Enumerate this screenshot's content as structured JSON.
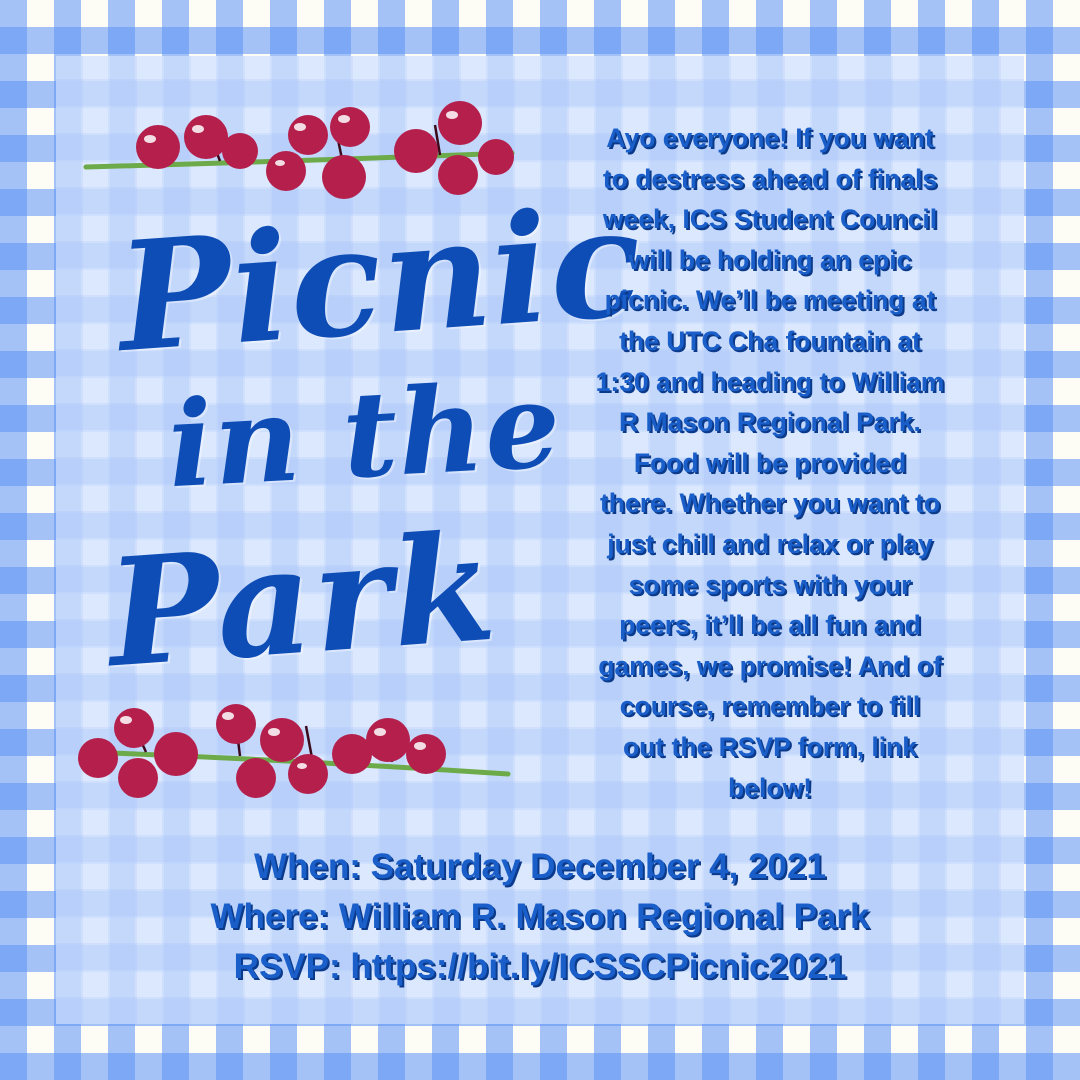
{
  "colors": {
    "gingham_blue": "#5c92f6",
    "gingham_cream": "#fdfdf6",
    "panel": "#d6e4ff",
    "text_blue": "#1a5fc9",
    "text_shadow": "#0b3a8a",
    "berry": "#b4204b",
    "berry_dark": "#7a1233",
    "stem": "#6dab4a"
  },
  "decorations": {
    "top_berries_icon": "berry-branch",
    "bottom_berries_icon": "berry-branch"
  },
  "title": {
    "line1": "Picnic",
    "line2": "in the",
    "line3": "Park"
  },
  "body_lines": [
    "Ayo everyone! If you want",
    "to destress ahead of finals",
    "week, ICS Student Council",
    "will be holding an epic",
    "picnic. We’ll be meeting at",
    "the UTC Cha fountain at",
    "1:30 and heading to William",
    "R Mason Regional Park.",
    "Food will be provided",
    "there. Whether you want to",
    "just chill and relax or play",
    "some sports with your",
    "peers, it’ll be all fun and",
    "games, we promise! And of",
    "course, remember to fill",
    "out the RSVP form, link",
    "below!"
  ],
  "details": {
    "when": "When: Saturday December 4, 2021",
    "where": "Where: William R. Mason Regional Park",
    "rsvp": "RSVP: https://bit.ly/ICSSCPicnic2021"
  }
}
